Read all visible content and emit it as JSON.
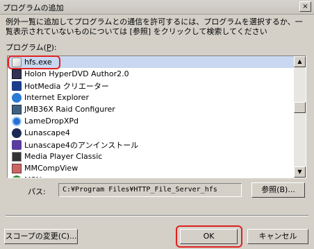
{
  "window": {
    "title": "プログラムの追加",
    "close_label": "×"
  },
  "description": "例外一覧に追加してプログラムとの通信を許可するには、プログラムを選択するか、一覧表示されていないものについては [参照] をクリックして検索してください",
  "list": {
    "label": "プログラム(",
    "label_mnemonic": "P",
    "label_suffix": "):",
    "items": [
      {
        "label": "hfs.exe",
        "icon": "exe-icon",
        "selected": true
      },
      {
        "label": "Holon HyperDVD Author2.0",
        "icon": "dvd-author-icon"
      },
      {
        "label": "HotMedia クリエーター",
        "icon": "hotmedia-icon"
      },
      {
        "label": "Internet Explorer",
        "icon": "internet-explorer-icon"
      },
      {
        "label": "JMB36X Raid Configurer",
        "icon": "raid-configurer-icon"
      },
      {
        "label": "LameDropXPd",
        "icon": "lamedrop-icon"
      },
      {
        "label": "Lunascape4",
        "icon": "lunascape-icon"
      },
      {
        "label": "Lunascape4のアンインストール",
        "icon": "uninstall-icon"
      },
      {
        "label": "Media Player Classic",
        "icon": "media-player-icon"
      },
      {
        "label": "MMCompView",
        "icon": "mmcompview-icon"
      },
      {
        "label": "MSN",
        "icon": "msn-icon"
      }
    ]
  },
  "path": {
    "label": "パス:",
    "value": "C:¥Program Files¥HTTP_File_Server_hfs"
  },
  "buttons": {
    "browse": "参照(B)...",
    "scope": "スコープの変更(C)...",
    "ok": "OK",
    "cancel": "キャンセル"
  },
  "colors": {
    "dialog_bg": "#d4d0c8",
    "highlight_annotation": "#e02020",
    "selected_row": "#c9d8f0"
  }
}
